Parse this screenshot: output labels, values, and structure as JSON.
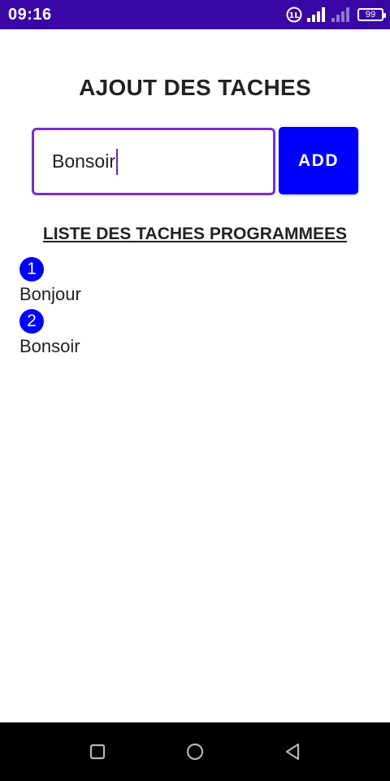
{
  "status_bar": {
    "time": "09:16",
    "battery_level": "99",
    "icons": [
      "lte-icon",
      "signal-icon",
      "signal-weak-icon",
      "battery-icon"
    ]
  },
  "header": {
    "title": "AJOUT DES TACHES"
  },
  "task_form": {
    "input_value": "Bonsoir",
    "add_label": "ADD",
    "accent_color": "#0000ff",
    "input_border_color": "#7b2ad6"
  },
  "task_list": {
    "heading": "LISTE DES TACHES PROGRAMMEES",
    "items": [
      {
        "number": "1",
        "label": "Bonjour"
      },
      {
        "number": "2",
        "label": "Bonsoir"
      }
    ]
  },
  "nav_bar": {
    "icons": [
      "recents-icon",
      "home-icon",
      "back-icon"
    ]
  }
}
